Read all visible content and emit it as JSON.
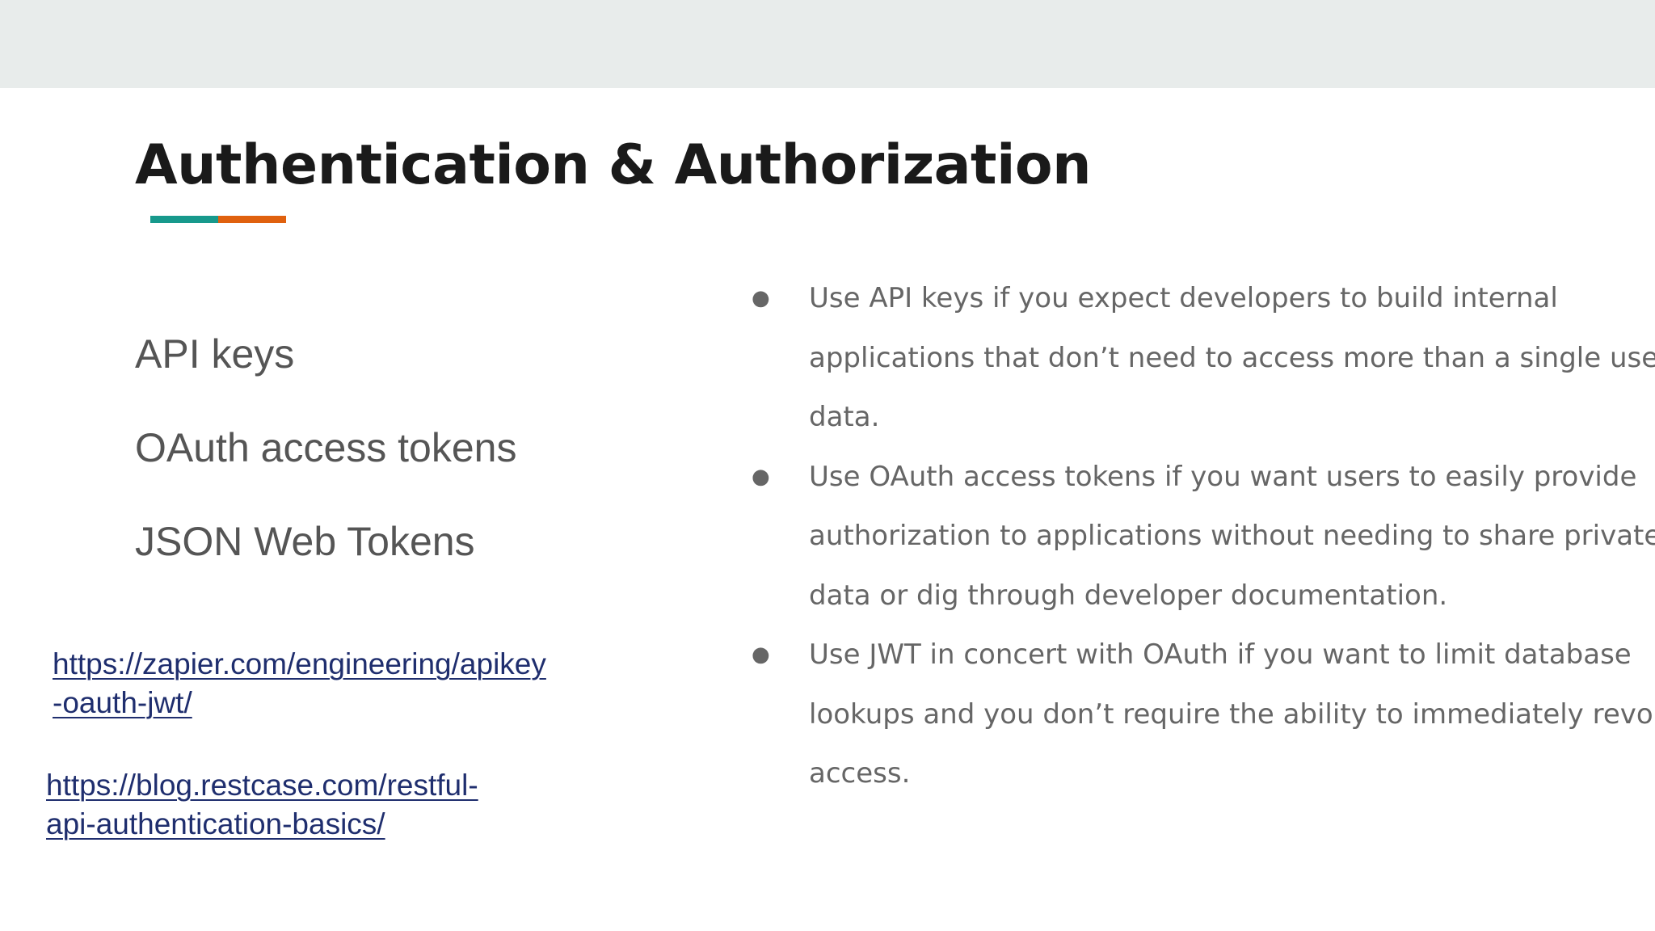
{
  "slide": {
    "title": "Authentication & Authorization",
    "accent_colors": [
      "#17998c",
      "#e0610e"
    ]
  },
  "left_list": [
    "API keys",
    "OAuth access tokens",
    "JSON Web Tokens"
  ],
  "links": [
    {
      "lines": [
        "https://zapier.com/engineering/apikey",
        "-oauth-jwt/"
      ]
    },
    {
      "lines": [
        "https://blog.restcase.com/restful-",
        "api-authentication-basics/"
      ]
    }
  ],
  "bullets": [
    {
      "marker": "●",
      "lines": [
        "Use API keys if you expect developers to build internal",
        "applications that don’t need to access more than a single user’s",
        "data."
      ]
    },
    {
      "marker": "●",
      "lines": [
        "Use OAuth access tokens if you want users to easily provide",
        "authorization to applications without needing to share private",
        "data or dig through developer documentation."
      ]
    },
    {
      "marker": "●",
      "lines": [
        "Use JWT in concert with OAuth if you want to limit database",
        "lookups and you don’t require the ability to immediately revoke",
        "access."
      ]
    }
  ]
}
